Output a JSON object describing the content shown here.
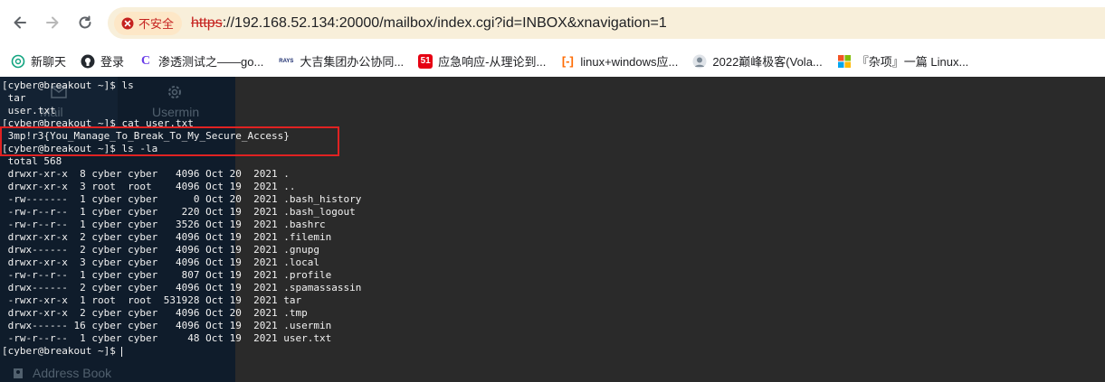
{
  "browser": {
    "security_label": "不安全",
    "url_scheme": "https",
    "url_rest": "://192.168.52.134:20000/mailbox/index.cgi?id=INBOX&xnavigation=1"
  },
  "bookmarks": [
    {
      "label": "新聊天",
      "icon": "chatgpt-icon"
    },
    {
      "label": "登录",
      "icon": "github-icon"
    },
    {
      "label": "渗透测试之——go...",
      "icon": "c-logo-icon"
    },
    {
      "label": "大吉集团办公协同...",
      "icon": "rays-logo-icon"
    },
    {
      "label": "应急响应-从理论到...",
      "icon": "51-logo-icon"
    },
    {
      "label": "linux+windows应...",
      "icon": "bracket-logo-icon"
    },
    {
      "label": "2022巅峰极客(Vola...",
      "icon": "avatar-icon"
    },
    {
      "label": "『杂项』一篇 Linux...",
      "icon": "windows-logo-icon"
    }
  ],
  "sidebar": {
    "mail_label": "Mail",
    "usermin_label": "Usermin",
    "address_book_label": "Address Book"
  },
  "terminal": {
    "lines": [
      "[cyber@breakout ~]$ ls",
      " tar",
      " user.txt",
      "[cyber@breakout ~]$ cat user.txt",
      " 3mp!r3{You_Manage_To_Break_To_My_Secure_Access}",
      "[cyber@breakout ~]$ ls -la",
      " total 568",
      " drwxr-xr-x  8 cyber cyber   4096 Oct 20  2021 .",
      " drwxr-xr-x  3 root  root    4096 Oct 19  2021 ..",
      " -rw-------  1 cyber cyber      0 Oct 20  2021 .bash_history",
      " -rw-r--r--  1 cyber cyber    220 Oct 19  2021 .bash_logout",
      " -rw-r--r--  1 cyber cyber   3526 Oct 19  2021 .bashrc",
      " drwxr-xr-x  2 cyber cyber   4096 Oct 19  2021 .filemin",
      " drwx------  2 cyber cyber   4096 Oct 19  2021 .gnupg",
      " drwxr-xr-x  3 cyber cyber   4096 Oct 19  2021 .local",
      " -rw-r--r--  1 cyber cyber    807 Oct 19  2021 .profile",
      " drwx------  2 cyber cyber   4096 Oct 19  2021 .spamassassin",
      " -rwxr-xr-x  1 root  root  531928 Oct 19  2021 tar",
      " drwxr-xr-x  2 cyber cyber   4096 Oct 20  2021 .tmp",
      " drwx------ 16 cyber cyber   4096 Oct 19  2021 .usermin",
      " -rw-r--r--  1 cyber cyber     48 Oct 19  2021 user.txt"
    ],
    "prompt": "[cyber@breakout ~]$ "
  },
  "colors": {
    "insecure_red": "#c5221f",
    "omnibox_bg": "#f8efda",
    "terminal_bg": "#2a2a2a",
    "highlight_red": "#e02222"
  }
}
